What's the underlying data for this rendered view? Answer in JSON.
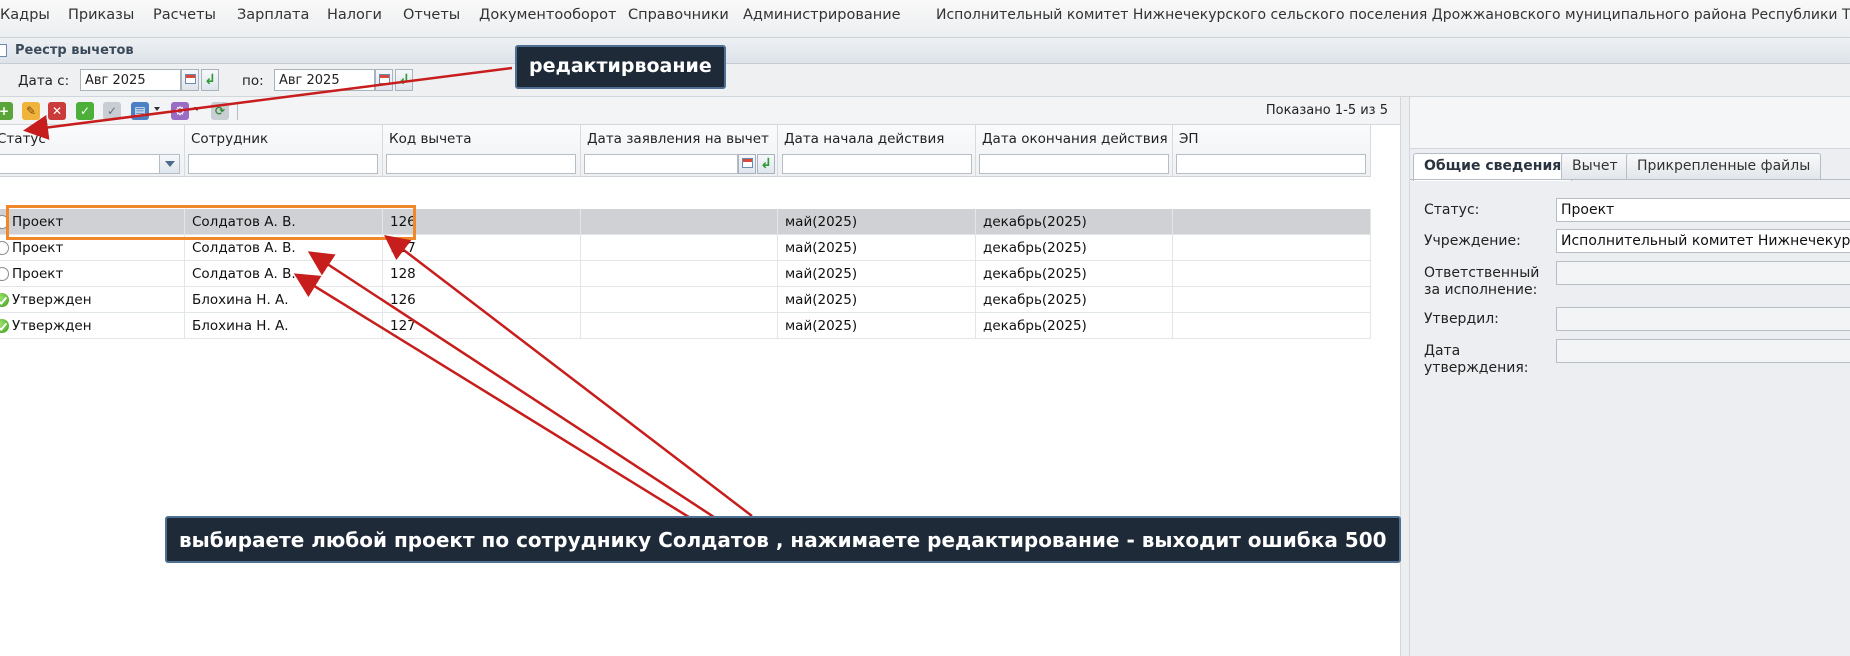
{
  "menu": {
    "items": [
      "Кадры",
      "Приказы",
      "Расчеты",
      "Зарплата",
      "Налоги",
      "Отчеты",
      "Документооборот",
      "Справочники",
      "Администрирование"
    ],
    "org_title": "Исполнительный комитет Нижнечекурского сельского поселения Дрожжановского муниципального района Республики Татарстан"
  },
  "panel": {
    "title": "Реестр вычетов"
  },
  "date_filter": {
    "from_label": "Дата с:",
    "from_value": "Авг 2025",
    "to_label": "по:",
    "to_value": "Авг 2025"
  },
  "toolbar": {
    "icons": [
      "add-icon",
      "edit-icon",
      "delete-icon",
      "approve-icon",
      "check-icon",
      "print-icon",
      "actions-icon",
      "refresh-icon"
    ],
    "shown_count": "Показано 1-5 из 5"
  },
  "grid": {
    "columns": [
      "Статус",
      "Сотрудник",
      "Код вычета",
      "Дата заявления на вычет",
      "Дата начала действия",
      "Дата окончания действия",
      "ЭП"
    ],
    "rows": [
      {
        "status": "Проект",
        "status_icon": "project-status-icon",
        "employee": "Солдатов А. В.",
        "code": "126",
        "application_date": "",
        "start": "май(2025)",
        "end": "декабрь(2025)",
        "ep": ""
      },
      {
        "status": "Проект",
        "status_icon": "project-status-icon",
        "employee": "Солдатов А. В.",
        "code": "127",
        "application_date": "",
        "start": "май(2025)",
        "end": "декабрь(2025)",
        "ep": ""
      },
      {
        "status": "Проект",
        "status_icon": "project-status-icon",
        "employee": "Солдатов А. В.",
        "code": "128",
        "application_date": "",
        "start": "май(2025)",
        "end": "декабрь(2025)",
        "ep": ""
      },
      {
        "status": "Утвержден",
        "status_icon": "approved-status-icon",
        "employee": "Блохина Н. А.",
        "code": "126",
        "application_date": "",
        "start": "май(2025)",
        "end": "декабрь(2025)",
        "ep": ""
      },
      {
        "status": "Утвержден",
        "status_icon": "approved-status-icon",
        "employee": "Блохина Н. А.",
        "code": "127",
        "application_date": "",
        "start": "май(2025)",
        "end": "декабрь(2025)",
        "ep": ""
      }
    ]
  },
  "details": {
    "tabs": [
      "Общие сведения",
      "Вычет",
      "Прикрепленные файлы"
    ],
    "fields": [
      {
        "label": "Статус:",
        "value": "Проект"
      },
      {
        "label": "Учреждение:",
        "value": "Исполнительный комитет Нижнечекурского"
      },
      {
        "label": "Ответственный за исполнение:",
        "value": ""
      },
      {
        "label": "Утвердил:",
        "value": ""
      },
      {
        "label": "Дата утверждения:",
        "value": ""
      }
    ]
  },
  "annotations": {
    "edit_callout": "редактирвоание",
    "instruction_callout": "выбираете любой проект по сотруднику Солдатов , нажимаете редактирование - выходит ошибка 500",
    "highlight_color": "#f0882a",
    "arrow_color": "#c81d1d"
  }
}
